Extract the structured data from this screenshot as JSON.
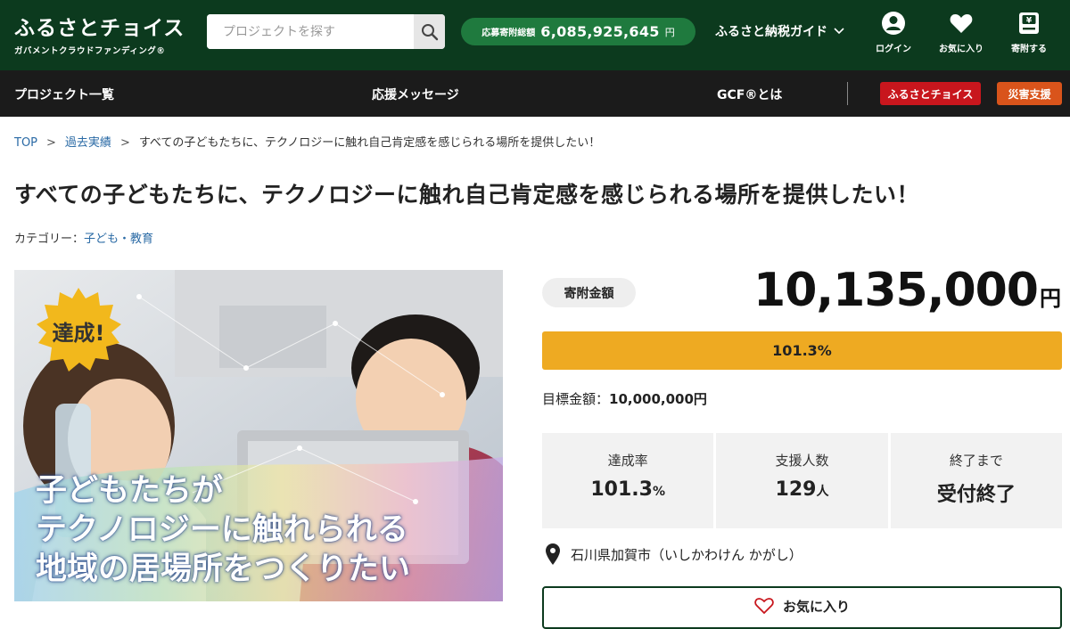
{
  "header": {
    "logo_main": "ふるさとチョイス",
    "logo_sub": "ガバメントクラウドファンディング®",
    "search_placeholder": "プロジェクトを探す",
    "total_label": "応募寄附総額",
    "total_value": "6,085,925,645",
    "total_unit": "円",
    "guide_label": "ふるさと納税ガイド",
    "login_label": "ログイン",
    "favorites_label": "お気に入り",
    "donate_label": "寄附する"
  },
  "nav": {
    "projects": "プロジェクト一覧",
    "messages": "応援メッセージ",
    "gcf_about": "GCF®とは",
    "furusato_choice": "ふるさとチョイス",
    "disaster_support": "災害支援"
  },
  "breadcrumb": {
    "top": "TOP",
    "sep": ">",
    "past": "過去実績",
    "current": "すべての子どもたちに、テクノロジーに触れ自己肯定感を感じられる場所を提供したい！"
  },
  "project": {
    "title": "すべての子どもたちに、テクノロジーに触れ自己肯定感を感じられる場所を提供したい！",
    "category_label": "カテゴリー：",
    "category_value": "子ども・教育",
    "image_badge": "達成!",
    "image_caption_line1": "子どもたちが",
    "image_caption_line2": "テクノロジーに触れられる",
    "image_caption_line3": "地域の居場所をつくりたい"
  },
  "funding": {
    "amount_label": "寄附金額",
    "amount_value": "10,135,000",
    "amount_unit": "円",
    "progress_text": "101.3%",
    "progress_fraction": 1.0,
    "goal_label": "目標金額：",
    "goal_value": "10,000,000円",
    "stats": [
      {
        "label": "達成率",
        "value": "101.3",
        "unit": "%"
      },
      {
        "label": "支援人数",
        "value": "129",
        "unit": "人"
      },
      {
        "label": "終了まで",
        "value": "受付終了",
        "unit": ""
      }
    ],
    "location": "石川県加賀市（いしかわけん かがし）",
    "favorite_button": "お気に入り"
  },
  "colors": {
    "header_bg": "#0c3a1e",
    "total_pill": "#1f7a3e",
    "nav_bg": "#1b1b1b",
    "choice_pill": "#c8161d",
    "disaster_pill": "#d9541b",
    "progress_fill": "#eeaa22",
    "badge_yellow": "#f2b81c",
    "link": "#2a6aa5"
  }
}
